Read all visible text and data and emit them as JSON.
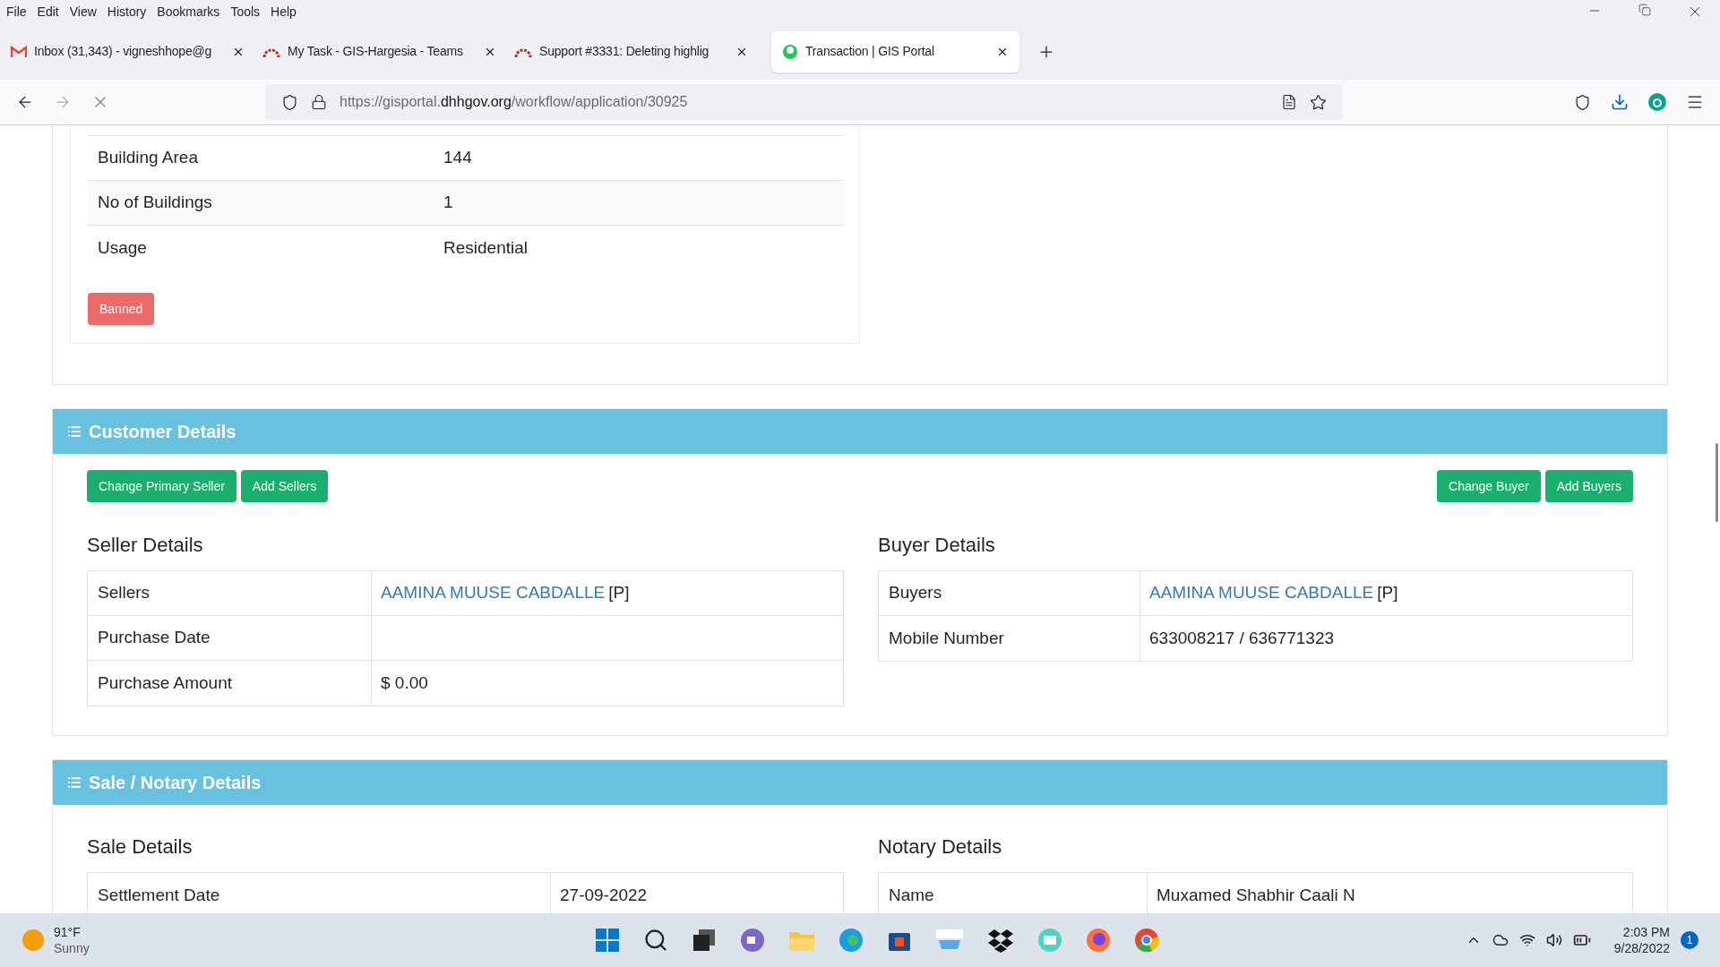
{
  "menu_bar": [
    "File",
    "Edit",
    "View",
    "History",
    "Bookmarks",
    "Tools",
    "Help"
  ],
  "tabs": [
    {
      "title": "Inbox (31,343) - vigneshhope@g",
      "kind": "mail",
      "selected": false
    },
    {
      "title": "My Task - GIS-Hargesia - Teams",
      "kind": "arc",
      "selected": false
    },
    {
      "title": "Support #3331: Deleting highlig",
      "kind": "arc",
      "selected": false
    },
    {
      "title": "Transaction | GIS Portal",
      "kind": "globe",
      "selected": true
    }
  ],
  "address": {
    "prefix": "https://gisportal.",
    "domain": "dhhgov.org",
    "path": "/workflow/application/30925"
  },
  "property_rows": [
    {
      "label": "Building Area",
      "value": "144"
    },
    {
      "label": "No of Buildings",
      "value": "1"
    },
    {
      "label": "Usage",
      "value": "Residential"
    }
  ],
  "status_badge": "Banned",
  "customer": {
    "title": "Customer Details",
    "seller_buttons": [
      "Change Primary Seller",
      "Add Sellers"
    ],
    "buyer_buttons": [
      "Change Buyer",
      "Add Buyers"
    ],
    "seller": {
      "heading": "Seller Details",
      "rows": [
        {
          "label": "Sellers",
          "link": "AAMINA MUUSE CABDALLE",
          "suffix": "[P]"
        },
        {
          "label": "Purchase Date",
          "value": ""
        },
        {
          "label": "Purchase Amount",
          "value": "$ 0.00"
        }
      ]
    },
    "buyer": {
      "heading": "Buyer Details",
      "rows": [
        {
          "label": "Buyers",
          "link": "AAMINA MUUSE CABDALLE",
          "suffix": "[P]"
        },
        {
          "label": "Mobile Number",
          "value": "633008217 / 636771323"
        }
      ]
    }
  },
  "sale": {
    "title": "Sale / Notary Details",
    "sale_heading": "Sale Details",
    "sale_rows": [
      {
        "label": "Settlement Date",
        "value": "27-09-2022"
      }
    ],
    "notary_heading": "Notary Details",
    "notary_rows": [
      {
        "label": "Name",
        "value": "Muxamed Shabhir Caali N"
      }
    ]
  },
  "taskbar": {
    "weather_temp": "91°F",
    "weather_text": "Sunny",
    "time": "2:03 PM",
    "date": "9/28/2022",
    "notification_count": "1"
  }
}
